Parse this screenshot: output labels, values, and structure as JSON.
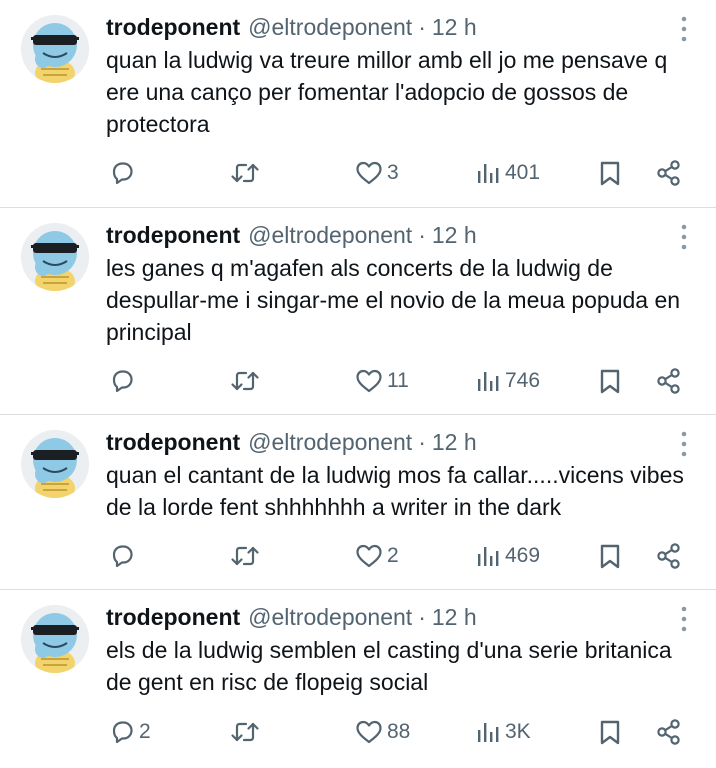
{
  "accent_color": "#536471",
  "tweets": [
    {
      "name": "trodeponent",
      "handle": "@eltrodeponent",
      "separator": "·",
      "time": "12 h",
      "text": "quan la ludwig va treure millor amb ell jo me pensave q ere una canço per fomentar l'adopcio de gossos de protectora",
      "replies": "",
      "retweets": "",
      "likes": "3",
      "views": "401"
    },
    {
      "name": "trodeponent",
      "handle": "@eltrodeponent",
      "separator": "·",
      "time": "12 h",
      "text": "les ganes q m'agafen als concerts de la ludwig de despullar-me i singar-me el novio de la meua popuda en principal",
      "replies": "",
      "retweets": "",
      "likes": "11",
      "views": "746"
    },
    {
      "name": "trodeponent",
      "handle": "@eltrodeponent",
      "separator": "·",
      "time": "12 h",
      "text": "quan el cantant de la ludwig mos fa callar.....vicens vibes de la lorde fent shhhhhhh a writer in the dark",
      "replies": "",
      "retweets": "",
      "likes": "2",
      "views": "469"
    },
    {
      "name": "trodeponent",
      "handle": "@eltrodeponent",
      "separator": "·",
      "time": "12 h",
      "text": "els de la ludwig semblen el casting d'una serie britanica de gent en risc de flopeig social",
      "replies": "2",
      "retweets": "",
      "likes": "88",
      "views": "3K"
    }
  ]
}
